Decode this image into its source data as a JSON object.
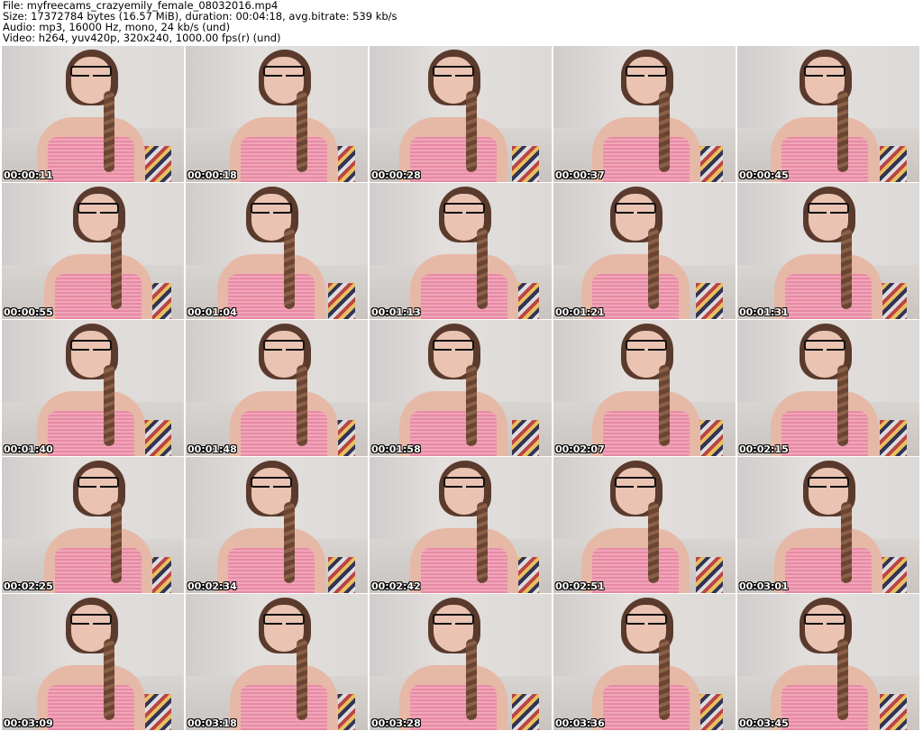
{
  "header": {
    "file": "File: myfreecams_crazyemily_female_08032016.mp4",
    "size": "Size: 17372784 bytes (16.57 MiB), duration: 00:04:18, avg.bitrate: 539 kb/s",
    "audio": "Audio: mp3, 16000 Hz, mono, 24 kb/s (und)",
    "video": "Video: h264, yuv420p, 320x240, 1000.00 fps(r) (und)"
  },
  "thumbnails": [
    {
      "time": "00:00:11"
    },
    {
      "time": "00:00:18"
    },
    {
      "time": "00:00:28"
    },
    {
      "time": "00:00:37"
    },
    {
      "time": "00:00:45"
    },
    {
      "time": "00:00:55"
    },
    {
      "time": "00:01:04"
    },
    {
      "time": "00:01:13"
    },
    {
      "time": "00:01:21"
    },
    {
      "time": "00:01:31"
    },
    {
      "time": "00:01:40"
    },
    {
      "time": "00:01:48"
    },
    {
      "time": "00:01:58"
    },
    {
      "time": "00:02:07"
    },
    {
      "time": "00:02:15"
    },
    {
      "time": "00:02:25"
    },
    {
      "time": "00:02:34"
    },
    {
      "time": "00:02:42"
    },
    {
      "time": "00:02:51"
    },
    {
      "time": "00:03:01"
    },
    {
      "time": "00:03:09"
    },
    {
      "time": "00:03:18"
    },
    {
      "time": "00:03:28"
    },
    {
      "time": "00:03:36"
    },
    {
      "time": "00:03:45"
    }
  ]
}
